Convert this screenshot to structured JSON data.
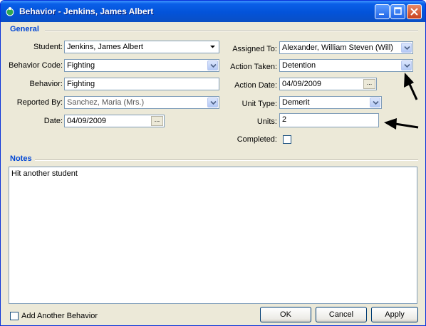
{
  "window": {
    "title": "Behavior - Jenkins, James Albert"
  },
  "general": {
    "group_title": "General",
    "student_label": "Student:",
    "student_value": "Jenkins, James Albert",
    "behavior_code_label": "Behavior Code:",
    "behavior_code_value": "Fighting",
    "behavior_label": "Behavior:",
    "behavior_value": "Fighting",
    "reported_by_label": "Reported By:",
    "reported_by_value": "Sanchez, Maria (Mrs.)",
    "date_label": "Date:",
    "date_value": "04/09/2009",
    "assigned_to_label": "Assigned To:",
    "assigned_to_value": "Alexander, William Steven (Will)",
    "action_taken_label": "Action Taken:",
    "action_taken_value": "Detention",
    "action_date_label": "Action Date:",
    "action_date_value": "04/09/2009",
    "unit_type_label": "Unit Type:",
    "unit_type_value": "Demerit",
    "units_label": "Units:",
    "units_value": "2",
    "completed_label": "Completed:",
    "date_button_glyph": "..."
  },
  "notes": {
    "group_title": "Notes",
    "text": "Hit another student"
  },
  "footer": {
    "add_another_label": "Add Another Behavior",
    "ok_label": "OK",
    "cancel_label": "Cancel",
    "apply_label": "Apply"
  }
}
